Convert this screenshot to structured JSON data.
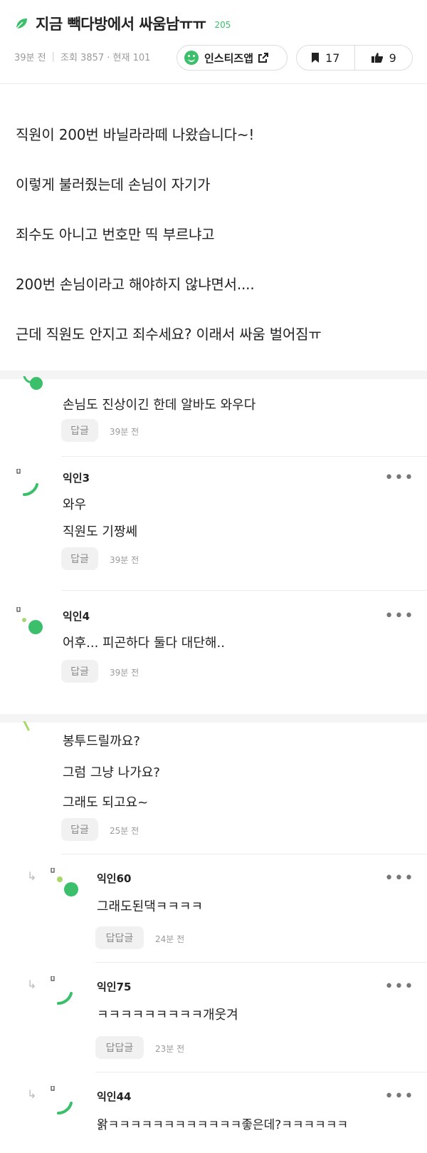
{
  "post": {
    "title": "지금 빽다방에서 싸움남ㅠㅠ",
    "title_count": "205",
    "time": "39분 전",
    "views": "조회 3857 · 현재 101",
    "insta_label": "인스티즈앱",
    "bookmarks": "17",
    "likes": "9",
    "body_lines": [
      "직원이 200번 바닐라라떼 나왔습니다~!",
      "이렇게 불러줬는데 손님이 자기가",
      "죄수도 아니고 번호만 띡 부르냐고",
      "200번 손님이라고 해야하지 않냐면서....",
      "근데 직원도 안지고 죄수세요? 이래서 싸움 벌어짐ㅠ"
    ]
  },
  "comments": [
    {
      "name": "",
      "lines": [
        "손님도 진상이긴 한데 알바도 와우다"
      ],
      "reply_label": "답글",
      "time": "39분 전"
    },
    {
      "name": "익인3",
      "lines": [
        "와우",
        "직원도 기짱쎄"
      ],
      "reply_label": "답글",
      "time": "39분 전"
    },
    {
      "name": "익인4",
      "lines": [
        "어후... 피곤하다 둘다 대단해.."
      ],
      "reply_label": "답글",
      "time": "39분 전"
    },
    {
      "name": "",
      "lines": [
        "봉투드릴까요?",
        "그럼 그냥 나가요?",
        "그래도 되고요~"
      ],
      "reply_label": "답글",
      "time": "25분 전"
    }
  ],
  "replies": [
    {
      "name": "익인60",
      "lines": [
        "그래도된댁ㅋㅋㅋㅋ"
      ],
      "reply_label": "답답글",
      "time": "24분 전"
    },
    {
      "name": "익인75",
      "lines": [
        "ㅋㅋㅋㅋㅋㅋㅋㅋㅋ개웃겨"
      ],
      "reply_label": "답답글",
      "time": "23분 전"
    },
    {
      "name": "익인44",
      "lines": [
        "왉ㅋㅋㅋㅋㅋㅋㅋㅋㅋㅋㅋㅋ좋은데?ㅋㅋㅋㅋㅋㅋ"
      ]
    }
  ],
  "colors": {
    "accent_green": "#3bbf6a",
    "background": "#f4f4f4"
  }
}
